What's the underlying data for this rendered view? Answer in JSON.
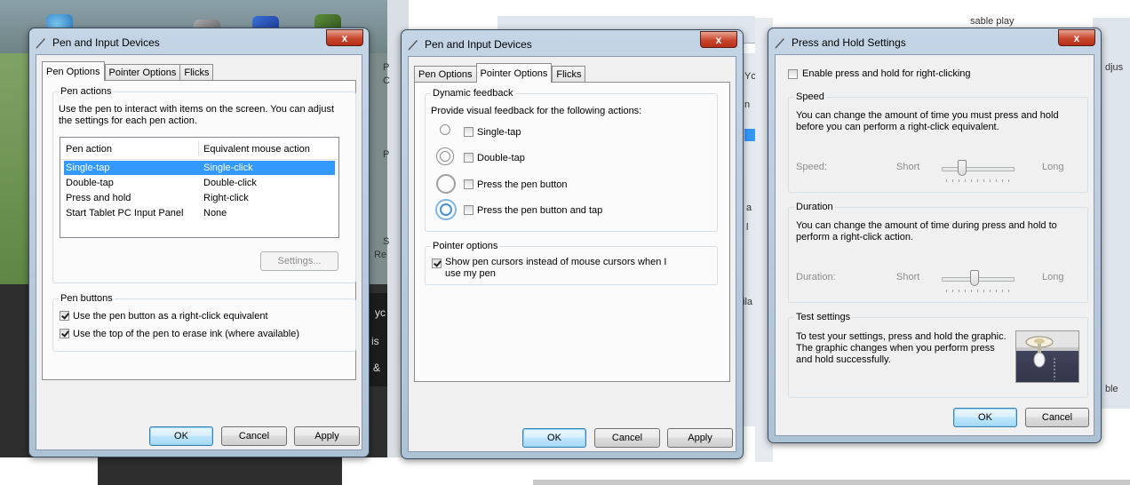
{
  "colors": {
    "title_bar": "#c4d5e6",
    "selection": "#3399ff",
    "close_button": "#c8452d",
    "default_button_border": "#3c7fb1",
    "disabled_text": "#8d8d8d"
  },
  "background": {
    "peek_texts": [
      "P",
      "C",
      "P",
      "S",
      "Re",
      "yc",
      "is",
      "&",
      "Yc",
      "n",
      "a",
      "l",
      "ila",
      "djus",
      "ble",
      "sable play"
    ]
  },
  "window1": {
    "title": "Pen and Input Devices",
    "close_glyph": "x",
    "tabs": [
      "Pen Options",
      "Pointer Options",
      "Flicks"
    ],
    "pen_actions": {
      "title": "Pen actions",
      "description_line1": "Use the pen to interact with items on the screen.  You can adjust",
      "description_line2": "the settings for each pen action.",
      "columns": [
        "Pen action",
        "Equivalent mouse action"
      ],
      "rows": [
        {
          "action": "Single-tap",
          "mouse": "Single-click"
        },
        {
          "action": "Double-tap",
          "mouse": "Double-click"
        },
        {
          "action": "Press and hold",
          "mouse": "Right-click"
        },
        {
          "action": "Start Tablet PC Input Panel",
          "mouse": "None"
        }
      ],
      "settings_button": "Settings..."
    },
    "pen_buttons": {
      "title": "Pen buttons",
      "option1": "Use the pen button as a right-click equivalent",
      "option2": "Use the top of the pen to erase ink (where available)"
    },
    "buttons": {
      "ok": "OK",
      "cancel": "Cancel",
      "apply": "Apply"
    }
  },
  "window2": {
    "title": "Pen and Input Devices",
    "close_glyph": "x",
    "tabs": [
      "Pen Options",
      "Pointer Options",
      "Flicks"
    ],
    "dynamic_feedback": {
      "title": "Dynamic feedback",
      "description": "Provide visual feedback for the following actions:",
      "options": [
        "Single-tap",
        "Double-tap",
        "Press the pen button",
        "Press the pen button and tap"
      ]
    },
    "pointer_options": {
      "title": "Pointer options",
      "option_line1": "Show pen cursors instead of mouse cursors when I",
      "option_line2": "use my pen"
    },
    "buttons": {
      "ok": "OK",
      "cancel": "Cancel",
      "apply": "Apply"
    }
  },
  "window3": {
    "title": "Press and Hold Settings",
    "close_glyph": "x",
    "enable_label": "Enable press and hold for right-clicking",
    "speed": {
      "title": "Speed",
      "description_line1": "You can change the amount of time you must press and hold",
      "description_line2": "before you can perform a right-click equivalent.",
      "label": "Speed:",
      "min_label": "Short",
      "max_label": "Long",
      "value_fraction": 0.25
    },
    "duration": {
      "title": "Duration",
      "description_line1": "You can change the amount of time during press and hold to",
      "description_line2": "perform a right-click action.",
      "label": "Duration:",
      "min_label": "Short",
      "max_label": "Long",
      "value_fraction": 0.45
    },
    "test": {
      "title": "Test settings",
      "description_line1": "To test your settings, press and hold the graphic.",
      "description_line2": "The graphic changes when you perform press",
      "description_line3": "and hold successfully."
    },
    "buttons": {
      "ok": "OK",
      "cancel": "Cancel"
    }
  }
}
